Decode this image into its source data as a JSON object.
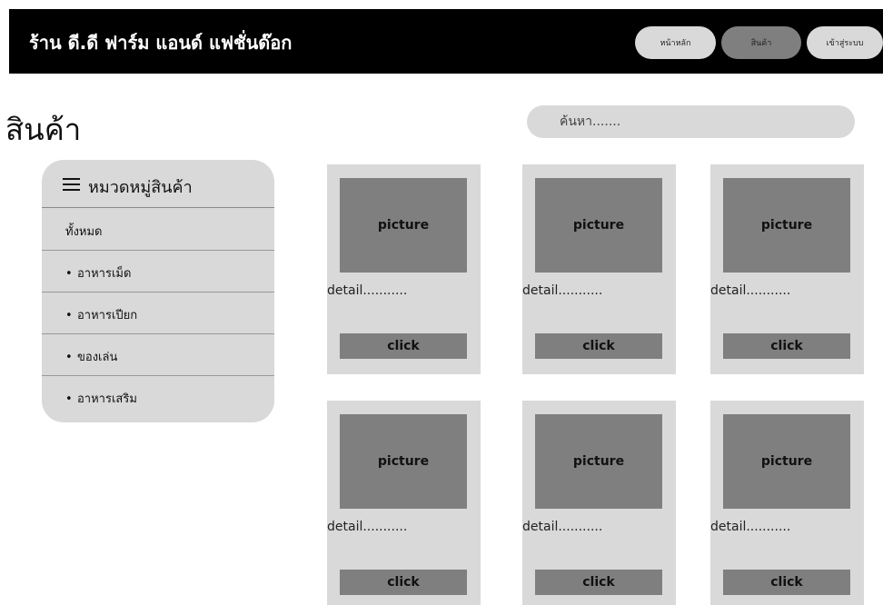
{
  "header": {
    "shop_name": "ร้าน ดี.ดี ฟาร์ม แอนด์ แฟชั่นด๊อก",
    "nav": {
      "home": "หน้าหลัก",
      "products": "สินค้า",
      "login": "เข้าสู่ระบบ"
    }
  },
  "page": {
    "title": "สินค้า"
  },
  "search": {
    "placeholder": "ค้นหา......."
  },
  "sidebar": {
    "title": "หมวดหมู่สินค้า",
    "icon": "menu-icon",
    "items": [
      {
        "label": "ทั้งหมด"
      },
      {
        "label": "อาหารเม็ด"
      },
      {
        "label": "อาหารเปียก"
      },
      {
        "label": "ของเล่น"
      },
      {
        "label": "อาหารเสริม"
      }
    ]
  },
  "products": [
    {
      "picture": "picture",
      "detail": "detail...........",
      "button": "click"
    },
    {
      "picture": "picture",
      "detail": "detail...........",
      "button": "click"
    },
    {
      "picture": "picture",
      "detail": "detail...........",
      "button": "click"
    },
    {
      "picture": "picture",
      "detail": "detail...........",
      "button": "click"
    },
    {
      "picture": "picture",
      "detail": "detail...........",
      "button": "click"
    },
    {
      "picture": "picture",
      "detail": "detail...........",
      "button": "click"
    }
  ],
  "colors": {
    "header_bg": "#000000",
    "panel_gray": "#d9d9d9",
    "dark_gray": "#7f7f7f"
  }
}
